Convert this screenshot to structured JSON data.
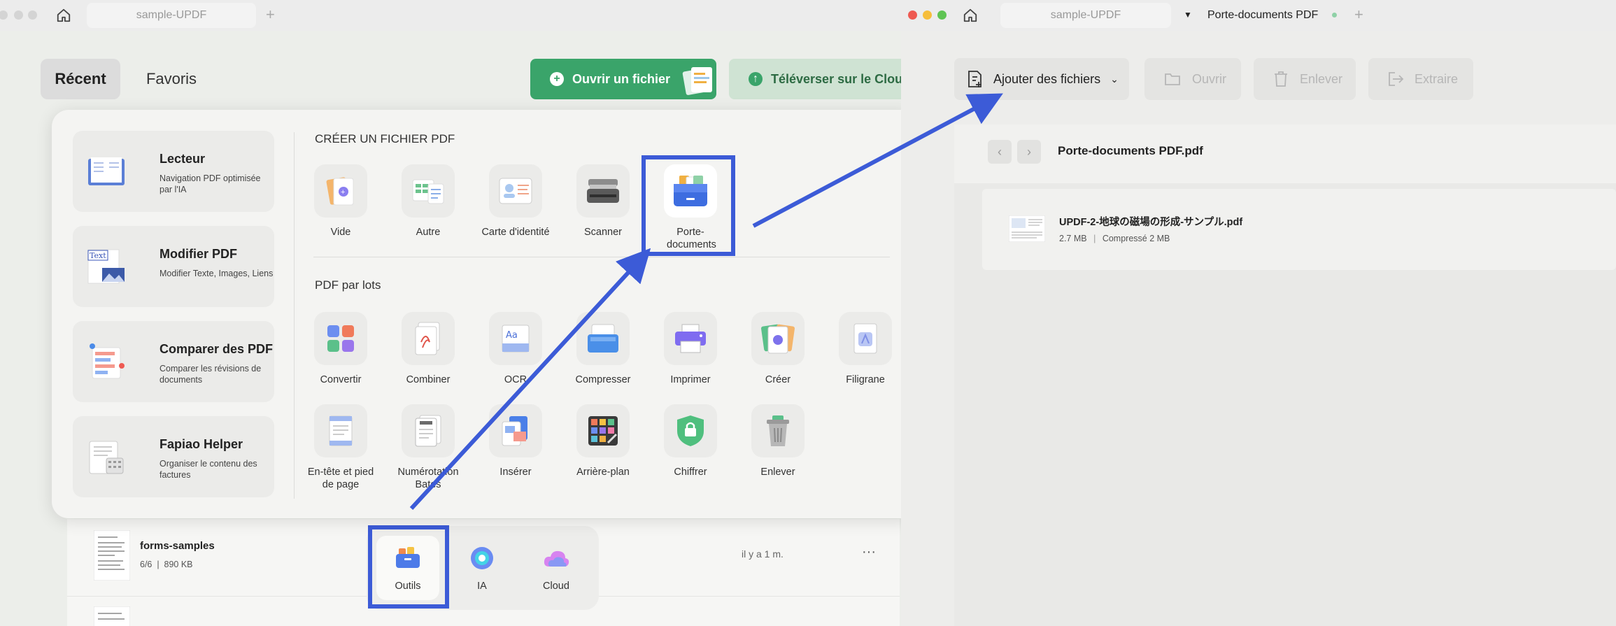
{
  "left_window": {
    "tab_title": "sample-UPDF",
    "nav_tabs": {
      "recent": "Récent",
      "favorites": "Favoris"
    },
    "open_file_label": "Ouvrir un fichier",
    "upload_cloud_label": "Téléverser sur le Cloud",
    "cards": [
      {
        "title": "Lecteur",
        "subtitle": "Navigation PDF optimisée par l'IA"
      },
      {
        "title": "Modifier PDF",
        "subtitle": "Modifier Texte, Images, Liens"
      },
      {
        "title": "Comparer des PDF",
        "subtitle": "Comparer les révisions de documents"
      },
      {
        "title": "Fapiao Helper",
        "subtitle": "Organiser le contenu des factures"
      }
    ],
    "create_section": "CRÉER UN FICHIER PDF",
    "create_tools": [
      "Vide",
      "Autre",
      "Carte d'identité",
      "Scanner",
      "Porte-documents"
    ],
    "batch_section": "PDF par lots",
    "batch_tools_row1": [
      "Convertir",
      "Combiner",
      "OCR",
      "Compresser",
      "Imprimer",
      "Créer",
      "Filigrane"
    ],
    "batch_tools_row2": [
      "En-tête et pied de page",
      "Numérotation Bates",
      "Insérer",
      "Arrière-plan",
      "Chiffrer",
      "Enlever"
    ],
    "recent_file": {
      "name": "forms-samples",
      "meta": "6/6  |  890 KB",
      "time": "il y a 1 m.",
      "more": "···"
    },
    "dock": [
      "Outils",
      "IA",
      "Cloud"
    ]
  },
  "right_window": {
    "tab_title": "sample-UPDF",
    "active_tab": "Porte-documents PDF",
    "toolbar": {
      "add_files": "Ajouter des fichiers",
      "open": "Ouvrir",
      "remove": "Enlever",
      "extract": "Extraire"
    },
    "portfolio_title": "Porte-documents PDF.pdf",
    "file": {
      "name": "UPDF-2-地球の磁場の形成-サンプル.pdf",
      "size": "2.7 MB",
      "compressed": "Compressé 2 MB"
    }
  },
  "colors": {
    "accent_green": "#3aa46a",
    "highlight_blue": "#3c5bd7",
    "traffic_red": "#ee5a52",
    "traffic_yellow": "#f6be3b",
    "traffic_green": "#5fc454"
  }
}
